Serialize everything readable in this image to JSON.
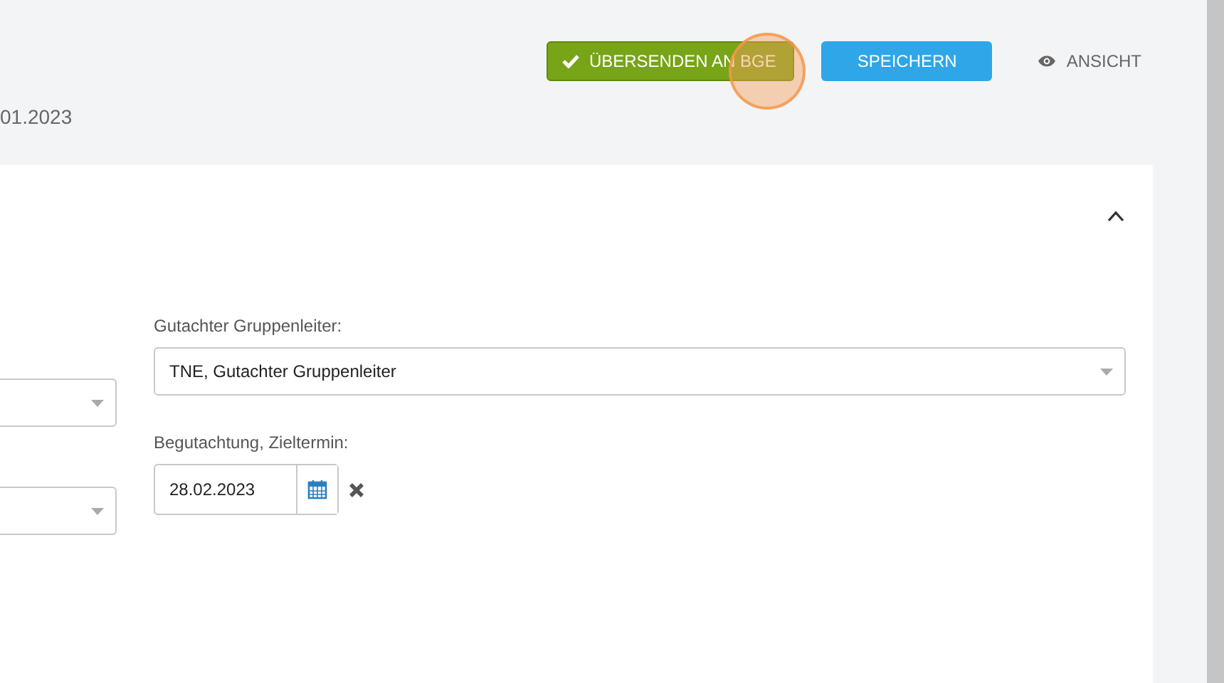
{
  "toolbar": {
    "buttons": [
      {
        "kind": "submit",
        "label": "ÜBERSENDEN AN BGE"
      },
      {
        "kind": "save",
        "label": "SPEICHERN"
      },
      {
        "kind": "view",
        "label": "ANSICHT"
      }
    ]
  },
  "header": {
    "date_fragment": "01.2023"
  },
  "panel": {
    "expanded": true,
    "left_fields": [
      {
        "kind": "select"
      },
      {
        "kind": "select"
      }
    ],
    "fields": [
      {
        "kind": "select",
        "label": "Gutachter Gruppenleiter:",
        "value": "TNE, Gutachter Gruppenleiter"
      },
      {
        "kind": "date",
        "label": "Begutachtung, Zieltermin:",
        "value": "28.02.2023"
      }
    ]
  }
}
